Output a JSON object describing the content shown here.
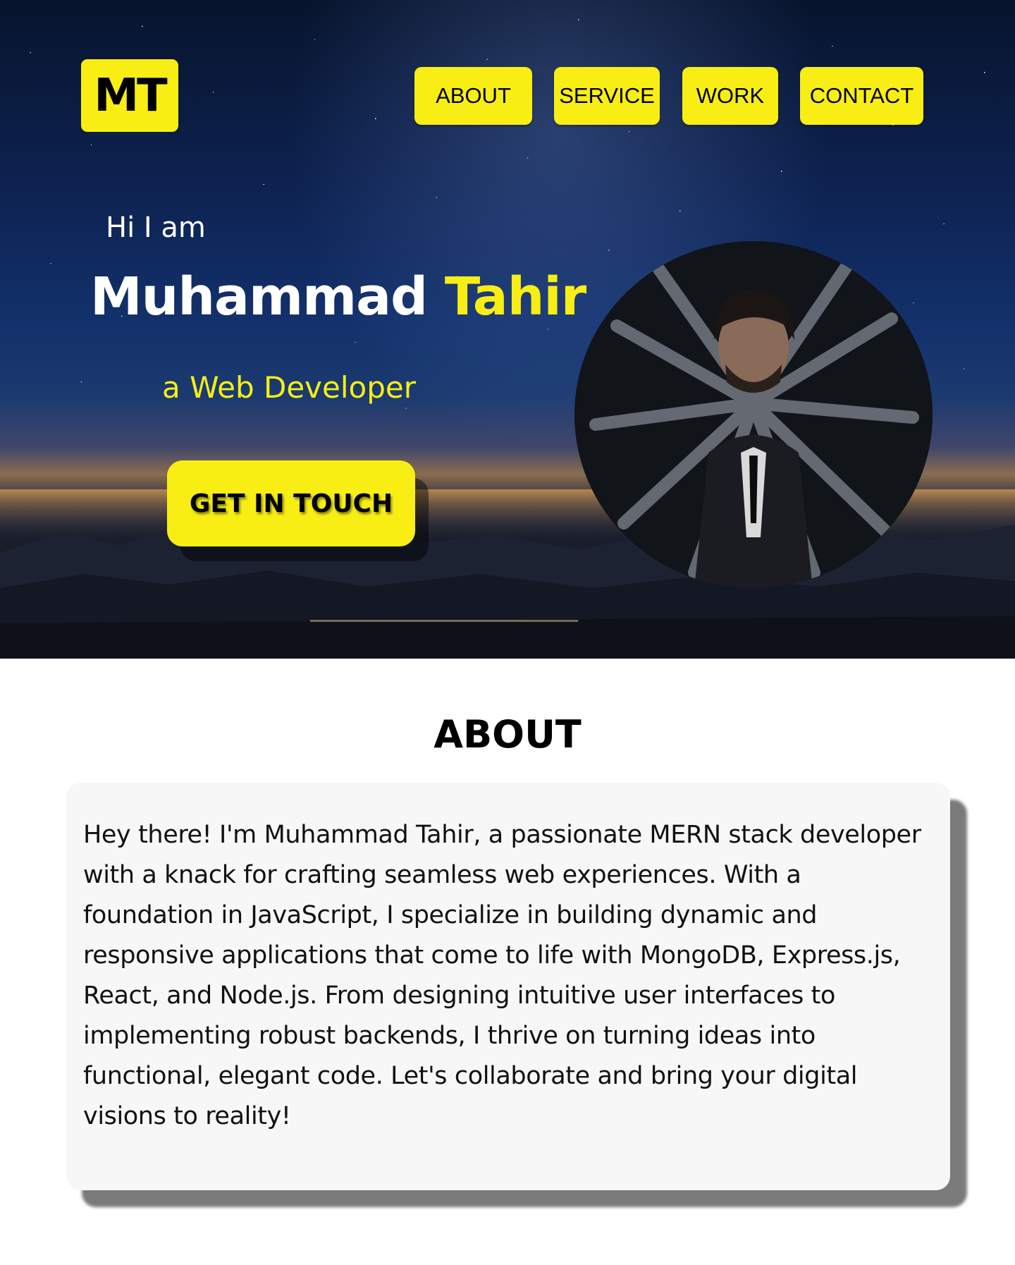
{
  "nav": {
    "logo": "MT",
    "items": [
      {
        "label": "ABOUT"
      },
      {
        "label": "SERVICE"
      },
      {
        "label": "WORK"
      },
      {
        "label": "CONTACT"
      }
    ]
  },
  "hero": {
    "greeting": "Hi I am",
    "first_name": "Muhammad",
    "last_name": "Tahir",
    "role": "a Web Developer",
    "cta_label": "GET IN TOUCH"
  },
  "about": {
    "heading": "ABOUT",
    "body": "Hey there! I'm Muhammad Tahir, a passionate MERN stack developer with a knack for crafting seamless web experiences. With a foundation in JavaScript, I specialize in building dynamic and responsive applications that come to life with MongoDB, Express.js, React, and Node.js. From designing intuitive user interfaces to implementing robust backends, I thrive on turning ideas into functional, elegant code. Let's collaborate and bring your digital visions to reality!"
  },
  "colors": {
    "accent": "#f8ee14",
    "text_dark": "#000000",
    "card_bg": "#f7f7f7"
  },
  "icons": {
    "hero_background": "starry-night-sky-image",
    "profile_photo": "profile-photo"
  }
}
